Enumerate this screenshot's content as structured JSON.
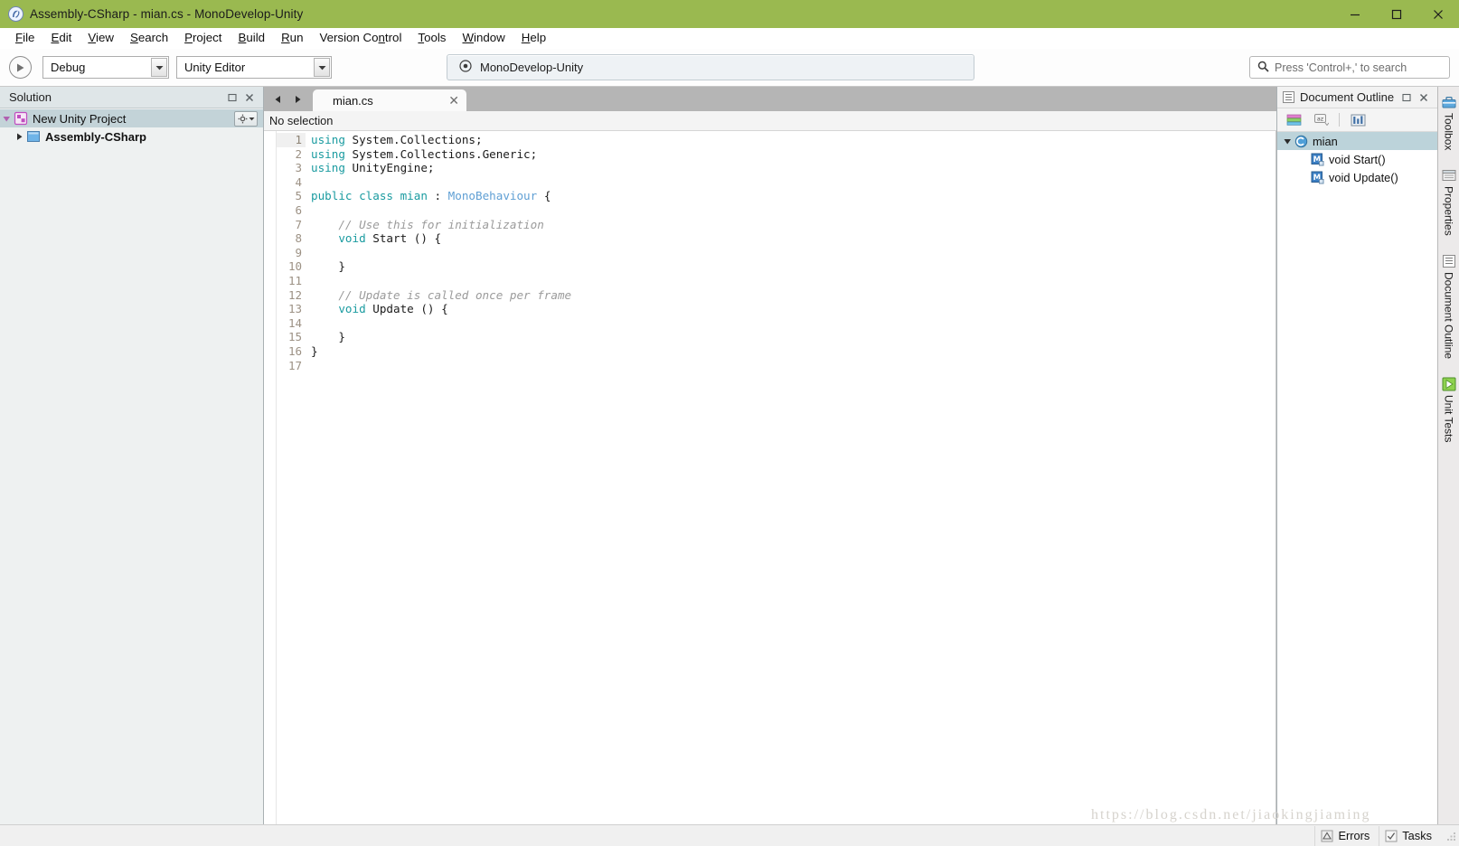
{
  "window": {
    "title": "Assembly-CSharp - mian.cs - MonoDevelop-Unity",
    "icon": "monodevelop-icon",
    "minimize_label": "—",
    "maximize_label": "□",
    "close_label": "✕",
    "titlebar_color": "#9ab950"
  },
  "menubar": {
    "items": [
      {
        "pre": "",
        "mnemonic": "F",
        "post": "ile"
      },
      {
        "pre": "",
        "mnemonic": "E",
        "post": "dit"
      },
      {
        "pre": "",
        "mnemonic": "V",
        "post": "iew"
      },
      {
        "pre": "",
        "mnemonic": "S",
        "post": "earch"
      },
      {
        "pre": "",
        "mnemonic": "P",
        "post": "roject"
      },
      {
        "pre": "",
        "mnemonic": "B",
        "post": "uild"
      },
      {
        "pre": "",
        "mnemonic": "R",
        "post": "un"
      },
      {
        "pre": "Version Co",
        "mnemonic": "n",
        "post": "trol"
      },
      {
        "pre": "",
        "mnemonic": "T",
        "post": "ools"
      },
      {
        "pre": "",
        "mnemonic": "W",
        "post": "indow"
      },
      {
        "pre": "",
        "mnemonic": "H",
        "post": "elp"
      }
    ]
  },
  "toolbar": {
    "run_button_icon": "play-icon",
    "configuration": {
      "value": "Debug",
      "arrow": "▼"
    },
    "runtime": {
      "value": "Unity Editor",
      "arrow": "▼"
    },
    "status_pill": {
      "icon": "target-icon",
      "text": "MonoDevelop-Unity"
    },
    "search": {
      "icon": "search-icon",
      "placeholder": "Press 'Control+,' to search",
      "value": ""
    }
  },
  "solution_pad": {
    "title": "Solution",
    "undock_label": "▫",
    "close_label": "✕",
    "tree": [
      {
        "label": "New Unity Project",
        "icon": "solution-icon",
        "twisty": "▼",
        "selected": true,
        "bold": false,
        "indent": 0,
        "has_gear": true
      },
      {
        "label": "Assembly-CSharp",
        "icon": "project-icon",
        "twisty": "▶",
        "selected": false,
        "bold": true,
        "indent": 1,
        "has_gear": false
      }
    ]
  },
  "editor": {
    "nav_back": "◀",
    "nav_forward": "▶",
    "tab": {
      "name": "mian.cs",
      "close_label": "✕"
    },
    "breadcrumb": "No selection",
    "active_line": 1,
    "lines": [
      {
        "n": 1,
        "tokens": [
          {
            "t": "using",
            "c": "kw"
          },
          {
            "t": " System.Collections;",
            "c": "pln"
          }
        ]
      },
      {
        "n": 2,
        "tokens": [
          {
            "t": "using",
            "c": "kw"
          },
          {
            "t": " System.Collections.Generic;",
            "c": "pln"
          }
        ]
      },
      {
        "n": 3,
        "tokens": [
          {
            "t": "using",
            "c": "kw"
          },
          {
            "t": " UnityEngine;",
            "c": "pln"
          }
        ]
      },
      {
        "n": 4,
        "tokens": []
      },
      {
        "n": 5,
        "tokens": [
          {
            "t": "public class mian",
            "c": "kw"
          },
          {
            "t": " : ",
            "c": "pln"
          },
          {
            "t": "MonoBehaviour",
            "c": "typ"
          },
          {
            "t": " {",
            "c": "pln"
          }
        ]
      },
      {
        "n": 6,
        "tokens": []
      },
      {
        "n": 7,
        "tokens": [
          {
            "t": "    // Use this for initialization",
            "c": "cmt"
          }
        ]
      },
      {
        "n": 8,
        "tokens": [
          {
            "t": "    ",
            "c": "pln"
          },
          {
            "t": "void",
            "c": "kw"
          },
          {
            "t": " Start () {",
            "c": "pln"
          }
        ]
      },
      {
        "n": 9,
        "tokens": []
      },
      {
        "n": 10,
        "tokens": [
          {
            "t": "    }",
            "c": "pln"
          }
        ]
      },
      {
        "n": 11,
        "tokens": []
      },
      {
        "n": 12,
        "tokens": [
          {
            "t": "    // Update is called once per frame",
            "c": "cmt"
          }
        ]
      },
      {
        "n": 13,
        "tokens": [
          {
            "t": "    ",
            "c": "pln"
          },
          {
            "t": "void",
            "c": "kw"
          },
          {
            "t": " Update () {",
            "c": "pln"
          }
        ]
      },
      {
        "n": 14,
        "tokens": []
      },
      {
        "n": 15,
        "tokens": [
          {
            "t": "    }",
            "c": "pln"
          }
        ]
      },
      {
        "n": 16,
        "tokens": [
          {
            "t": "}",
            "c": "pln"
          }
        ]
      },
      {
        "n": 17,
        "tokens": []
      }
    ],
    "syntax_colors": {
      "keyword": "#1a9ba0",
      "type": "#5f9fd4",
      "comment": "#9b9b9b",
      "plain": "#1b1b1b",
      "line_number": "#9c9184"
    }
  },
  "outline_pad": {
    "title": "Document Outline",
    "title_icon": "outline-icon",
    "undock_label": "▫",
    "close_label": "✕",
    "toolbar": [
      {
        "name": "group-by-category-icon",
        "label": ""
      },
      {
        "name": "sort-alphabetically-icon",
        "label": ""
      },
      {
        "name": "outline-options-icon",
        "label": ""
      }
    ],
    "tree": [
      {
        "label": "mian",
        "icon": "class-icon",
        "twisty": "▼",
        "selected": true,
        "indent": 0
      },
      {
        "label": "void Start()",
        "icon": "method-icon",
        "twisty": "",
        "selected": false,
        "indent": 1
      },
      {
        "label": "void Update()",
        "icon": "method-icon",
        "twisty": "",
        "selected": false,
        "indent": 1
      }
    ]
  },
  "dock_strip": {
    "tabs": [
      {
        "label": "Toolbox",
        "icon": "toolbox-icon"
      },
      {
        "label": "Properties",
        "icon": "properties-icon"
      },
      {
        "label": "Document Outline",
        "icon": "outline-icon"
      },
      {
        "label": "Unit Tests",
        "icon": "unit-tests-icon"
      }
    ]
  },
  "statusbar": {
    "errors": {
      "label": "Errors",
      "icon": "errors-icon"
    },
    "tasks": {
      "label": "Tasks",
      "icon": "tasks-icon"
    }
  },
  "watermark": {
    "text": "https://blog.csdn.net/jiaokingjiaming"
  }
}
